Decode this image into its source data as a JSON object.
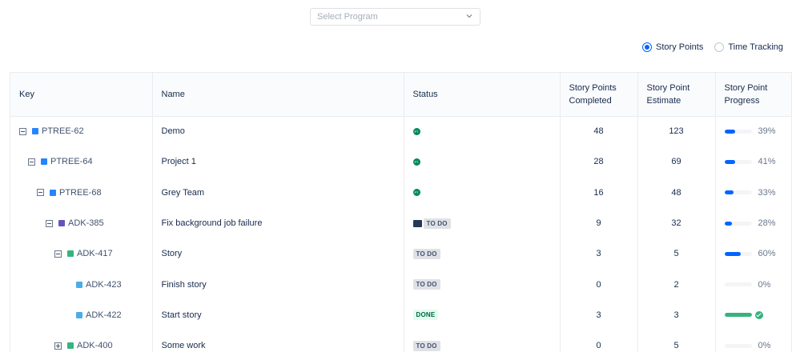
{
  "program_select": {
    "placeholder": "Select Program",
    "icon": "chevron-down-icon"
  },
  "mode": {
    "options": [
      {
        "label": "Story Points",
        "checked": true
      },
      {
        "label": "Time Tracking",
        "checked": false
      }
    ]
  },
  "columns": {
    "key": "Key",
    "name": "Name",
    "status": "Status",
    "completed": "Story Points Completed",
    "estimate": "Story Point Estimate",
    "progress": "Story Point Progress"
  },
  "rows": [
    {
      "key": "PTREE-62",
      "name": "Demo",
      "status_type": "avatar",
      "avatar": "PT",
      "completed": "48",
      "estimate": "123",
      "progress": 39,
      "progress_label": "39%",
      "indent": 0,
      "toggle": "minus",
      "type_color": "#2684ff"
    },
    {
      "key": "PTREE-64",
      "name": "Project 1",
      "status_type": "avatar",
      "avatar": "PT",
      "completed": "28",
      "estimate": "69",
      "progress": 41,
      "progress_label": "41%",
      "indent": 1,
      "toggle": "minus",
      "type_color": "#2684ff"
    },
    {
      "key": "PTREE-68",
      "name": "Grey Team",
      "status_type": "avatar",
      "avatar": "PT",
      "completed": "16",
      "estimate": "48",
      "progress": 33,
      "progress_label": "33%",
      "indent": 2,
      "toggle": "minus",
      "type_color": "#2684ff"
    },
    {
      "key": "ADK-385",
      "name": "Fix background job failure",
      "status_type": "avatar-lozenge",
      "status": "TO DO",
      "completed": "9",
      "estimate": "32",
      "progress": 28,
      "progress_label": "28%",
      "indent": 3,
      "toggle": "minus",
      "type_color": "#6554c0"
    },
    {
      "key": "ADK-417",
      "name": "Story",
      "status_type": "lozenge",
      "status": "TO DO",
      "completed": "3",
      "estimate": "5",
      "progress": 60,
      "progress_label": "60%",
      "indent": 4,
      "toggle": "minus",
      "type_color": "#36b37e"
    },
    {
      "key": "ADK-423",
      "name": "Finish story",
      "status_type": "lozenge",
      "status": "TO DO",
      "completed": "0",
      "estimate": "2",
      "progress": 0,
      "progress_label": "0%",
      "indent": 5,
      "toggle": "none",
      "type_color": "#4bade8"
    },
    {
      "key": "ADK-422",
      "name": "Start story",
      "status_type": "lozenge-done",
      "status": "DONE",
      "completed": "3",
      "estimate": "3",
      "progress": 100,
      "progress_label": "",
      "indent": 5,
      "toggle": "none",
      "type_color": "#4bade8"
    },
    {
      "key": "ADK-400",
      "name": "Some work",
      "status_type": "lozenge",
      "status": "TO DO",
      "completed": "0",
      "estimate": "5",
      "progress": 0,
      "progress_label": "0%",
      "indent": 4,
      "toggle": "plus",
      "type_color": "#36b37e"
    }
  ]
}
